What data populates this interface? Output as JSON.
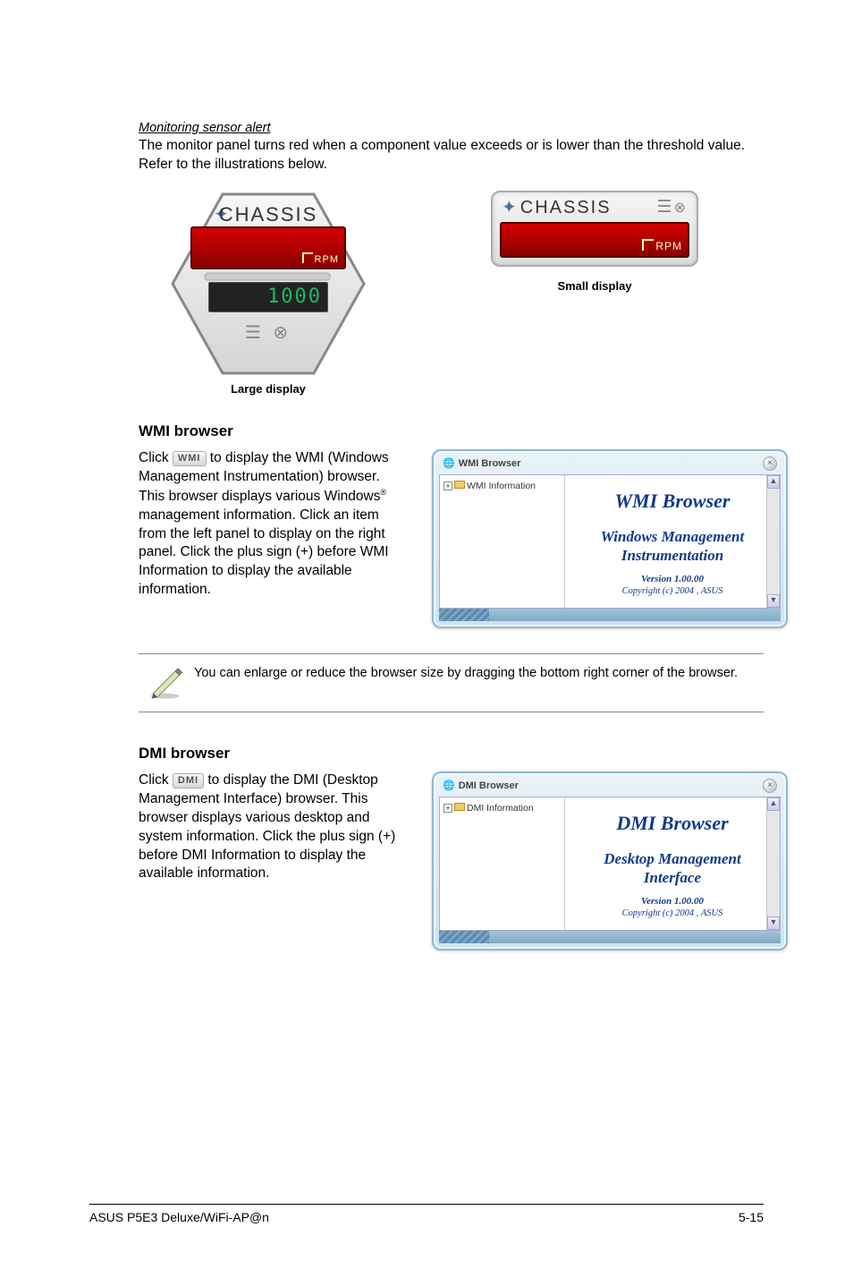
{
  "section_alert": {
    "heading": "Monitoring sensor alert",
    "body": "The monitor panel turns red when a component value exceeds or is lower than the threshold value. Refer to the illustrations below.",
    "large": {
      "label": "CHASSIS",
      "rpm_text": "RPM",
      "dark_value": "1000",
      "caption": "Large display"
    },
    "small": {
      "label": "CHASSIS",
      "rpm_text": "RPM",
      "caption": "Small display"
    }
  },
  "wmi": {
    "heading": "WMI browser",
    "para_pre": "Click ",
    "badge": "WMI",
    "para_post": " to display the WMI (Windows Management Instrumentation) browser. This browser displays various Windows",
    "reg": "®",
    "para_tail": " management information. Click an item from the left panel to display on the right panel. Click the plus sign (+) before WMI Information to display the available information.",
    "window": {
      "title": "WMI Browser",
      "tree_item": "WMI Information",
      "content_title": "WMI Browser",
      "content_sub1": "Windows Management",
      "content_sub2": "Instrumentation",
      "version": "Version 1.00.00",
      "copyright": "Copyright (c) 2004 , ASUS"
    }
  },
  "note": "You can enlarge or reduce the browser size by dragging the bottom right corner of the browser.",
  "dmi": {
    "heading": "DMI browser",
    "para_pre": "Click ",
    "badge": "DMI",
    "para_post": " to display the DMI (Desktop Management Interface) browser. This browser displays various desktop and system information. Click the plus sign (+) before DMI Information to display the available information.",
    "window": {
      "title": "DMI Browser",
      "tree_item": "DMI Information",
      "content_title": "DMI Browser",
      "content_sub1": "Desktop Management",
      "content_sub2": "Interface",
      "version": "Version 1.00.00",
      "copyright": "Copyright (c) 2004 , ASUS"
    }
  },
  "footer": {
    "left": "ASUS P5E3 Deluxe/WiFi-AP@n",
    "right": "5-15"
  }
}
